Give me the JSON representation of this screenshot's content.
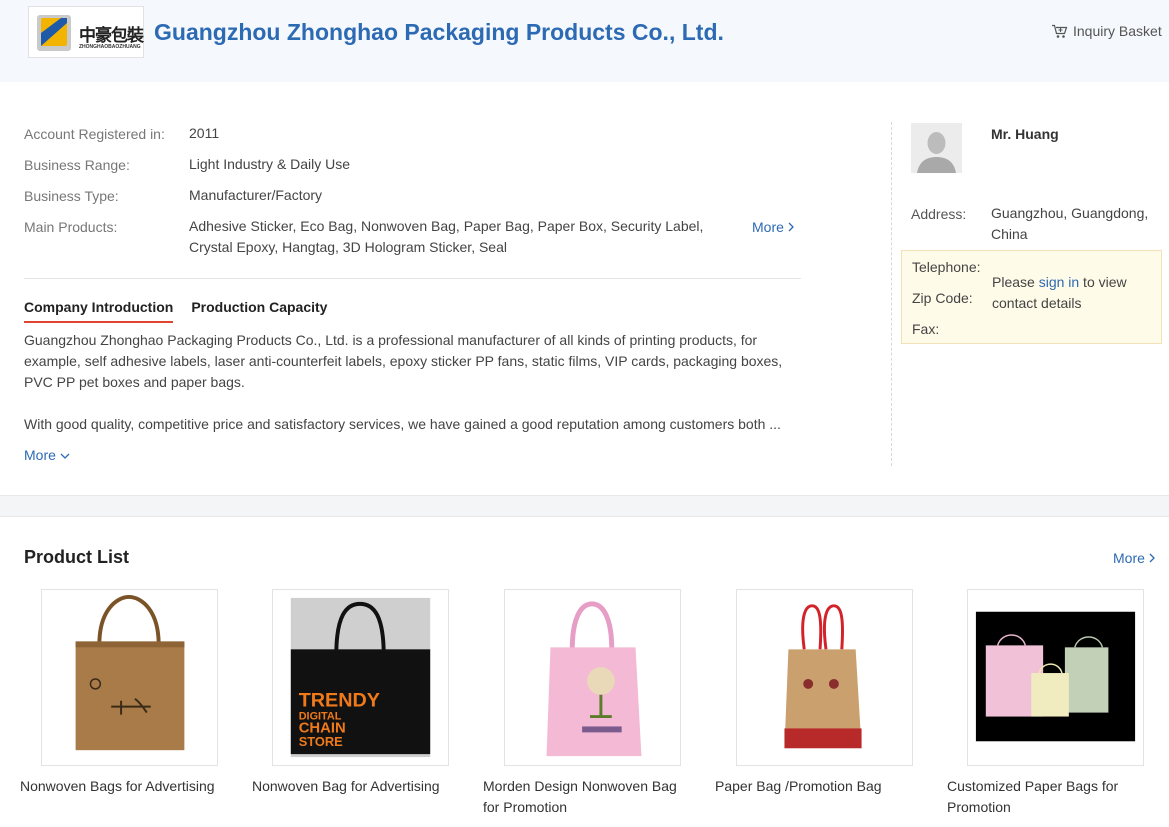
{
  "header": {
    "logo_text": "中豪包裝",
    "logo_subtext": "ZHONGHAOBAOZHUANG",
    "company_name": "Guangzhou Zhonghao Packaging Products Co., Ltd.",
    "inquiry_basket": "Inquiry Basket"
  },
  "info": {
    "registered_label": "Account Registered in:",
    "registered_value": "2011",
    "range_label": "Business Range:",
    "range_value": "Light Industry & Daily Use",
    "type_label": "Business Type:",
    "type_value": "Manufacturer/Factory",
    "products_label": "Main Products:",
    "products_value": "Adhesive Sticker, Eco Bag, Nonwoven Bag, Paper Bag, Paper Box, Security Label, Crystal Epoxy, Hangtag, 3D Hologram Sticker, Seal",
    "more": "More"
  },
  "tabs": {
    "intro": "Company Introduction",
    "capacity": "Production Capacity"
  },
  "intro": {
    "p1": "Guangzhou Zhonghao Packaging Products Co., Ltd. is a professional manufacturer of all kinds of printing products, for example, self adhesive labels, laser anti-counterfeit labels, epoxy sticker PP fans, static films, VIP cards, packaging boxes, PVC PP pet boxes and paper bags.",
    "p2": "With good quality, competitive price and satisfactory services, we have gained a good reputation among customers both ...",
    "more": "More"
  },
  "contact": {
    "name": "Mr. Huang",
    "address_label": "Address:",
    "address_value": "Guangzhou, Guangdong, China",
    "telephone_label": "Telephone:",
    "zip_label": "Zip Code:",
    "fax_label": "Fax:",
    "msg_prefix": "Please ",
    "sign_in": "sign in",
    "msg_suffix": " to view contact details"
  },
  "product_list": {
    "title": "Product List",
    "more": "More",
    "items": [
      {
        "name": "Nonwoven Bags for Advertising"
      },
      {
        "name": "Nonwoven Bag for Advertising",
        "print_big": "TRENDY",
        "print_small": "DIGITAL",
        "print_line3": "CHAIN",
        "print_line4": "STORE"
      },
      {
        "name": "Morden Design Nonwoven Bag for Promotion"
      },
      {
        "name": "Paper Bag /Promotion Bag"
      },
      {
        "name": "Customized Paper Bags for Promotion"
      }
    ]
  }
}
